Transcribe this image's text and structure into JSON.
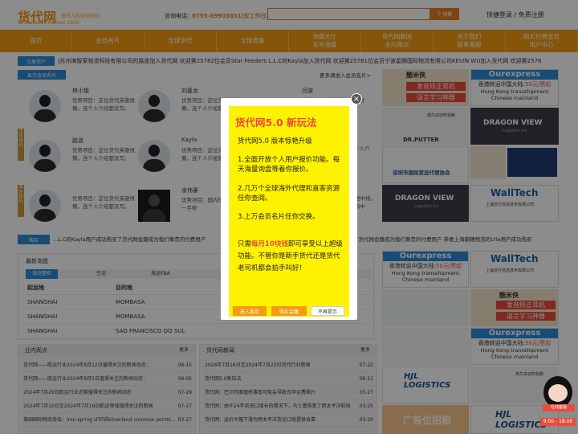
{
  "header": {
    "logo": "货代网",
    "logo_sub": "货代人的社交网站",
    "logo_url": "forwarders.cn  Since 2019",
    "phone_label": "咨询电话：",
    "phone": "0755-89903031(仅工作日)",
    "search_placeholder": "",
    "search_button": "搜集",
    "login": "快捷登录",
    "register": "免费注册"
  },
  "nav": [
    "首页",
    "会员名片",
    "全球货代",
    "全球直客",
    "询盘大厅\n发布询盘",
    "货代网新闻\n业内观点",
    "关于我们\n联系客服",
    "购买付费会员\n用户中心"
  ],
  "ticker": {
    "tag": "注册用户",
    "text": "|苏州海智家物流科技有限公司的路遥加入货代网      欢迎第25782位会员Star Feeders L.L.C的Kayla加入货代网      欢迎第25781位会员宁波星腾国际物流有限公司KEVIN WU加入货代网      欢迎第2578"
  },
  "cards_section": {
    "tag": "显示会员名片",
    "more": "更多请进入会员名片>"
  },
  "cards": [
    {
      "name": "林小姐",
      "desc": "优势项目：这位货代英雄很懒，连个人介绍都没写。"
    },
    {
      "name": "刘嘉龙",
      "desc": "优势项目：这位货代英雄很懒，连个人介绍都没写。"
    },
    {
      "name": "闫波",
      "desc": "优势项目：这位货代英雄很懒，连个人介绍都没写。"
    },
    {
      "name": "路遥",
      "desc": "优势项目：这位货代英雄很懒，连个人介绍都没写。"
    },
    {
      "name": "Kayla",
      "desc": "优势项目：这位货代英雄很懒，连个人介绍都没写。"
    },
    {
      "name": "",
      "desc": "这位货代英雄很懒，连个人介绍都没写。"
    },
    {
      "name": "",
      "desc": "优势项目：这位货代英雄很懒，连个人介绍都没写。"
    },
    {
      "name": "余伟豪",
      "desc": "优势项目：国内快递 NVO货、一手柜"
    },
    {
      "name": "",
      "desc": "地中线，和中"
    }
  ],
  "news_ticker": {
    "tag": "购买",
    "text": "...L.C的Kayla用户成功购买了货代网会籍成为我们尊贵的付费用户",
    "text_right": "了货代网会籍成为我们尊贵的付费用户      恭喜上海朝穗物流的LYle用户成功购买"
  },
  "routes": {
    "title": "最新询盘",
    "tabs": [
      "海运整柜",
      "空运",
      "海运FBA",
      "车"
    ],
    "headers": [
      "起运地",
      "目的地"
    ],
    "rows": [
      [
        "SHANGHAI",
        "MOMBASA"
      ],
      [
        "SHANGHAI",
        "MOMBASA"
      ],
      [
        "SHANGHAI",
        "SAO FRANCISCO DO SUL"
      ]
    ]
  },
  "lists": [
    {
      "title": "业内观点",
      "more": "更多",
      "rows": [
        [
          "货代网——航运行业2024年8月12日值得关注的新闻动态：",
          "08-15"
        ],
        [
          "货代网——航运行业2024年8月5日值得关注的新闻动态：",
          "08-05"
        ],
        [
          "2024年7月29日航运行业近期值得关注的新闻动态",
          "07-29"
        ],
        [
          "2024年7月10日至2024年7月16日航运领域值得关注的新闻",
          "07-17"
        ],
        [
          "美国国际物流协会：iron spring UT内陆Overland common points...",
          "03-27"
        ]
      ]
    },
    {
      "title": "货代网新闻",
      "more": "更多",
      "rows": [
        [
          "2024年7月16日至2024年7月22日货代行业新闻",
          "07-22"
        ],
        [
          "货代网5.0新玩法",
          "06-11"
        ],
        [
          "货代网：巴尔的摩撞桥事故可能会导致东岸运费飙升",
          "03-27"
        ],
        [
          "货代网：由于24年初进口增长的情况下，马士基恢复了跨太平洋航线",
          "03-25"
        ],
        [
          "货代网：运价大幅下滑为跨太平洋货运订舱提供肯靠",
          "03-20"
        ]
      ]
    }
  ],
  "ads": {
    "ourexpress": "Ourexpress",
    "ourexpress_sub": "香港转运中国大陆:",
    "ourexpress_price": "50元/票起",
    "ourexpress_en": "Hong Kong transshipment Chinese mainland",
    "kumi": "酷米侠",
    "kumi_sub": "发音矫正耳机",
    "kumi_sub2": "语言学习神器",
    "dragon": "DRAGON VIEW",
    "dragon_sub": "Logistics Inc",
    "drputter": "DR.PUTTER",
    "drputter_cn": "高尔夫切杆割刷",
    "wall": "WallTech",
    "wall_sub": "上海沃行信息技术有限公司",
    "shenzhen": "深圳市国际货运代理协会",
    "hjl": "HJL LOGISTICS",
    "ad_slot": "广告位招租"
  },
  "modal": {
    "title": "货代网5.0 新玩法",
    "l1": "货代网5.0 版本惊艳升级",
    "l2": "1.全面开放个人用户报价功能。每天海量询盘等着你报价。",
    "l3": "2.几万个全球海外代理和直客资源任你查阅。",
    "l4": "3.上万会员名片任你交换。",
    "l5a": "只需",
    "l5b": "每月10块钱",
    "l5c": "即可享受以上超级功能。不管你是新手货代还是货代老司机都会拍手叫好！",
    "btn1": "进入首页",
    "btn2": "购买会籍",
    "btn3": "不再提示"
  },
  "chat": {
    "label": "在线客服",
    "time": "9:00 - 18:00"
  },
  "colors": {
    "brand": "#f39c12",
    "blue": "#2a8ad8",
    "modal_bg": "#fff200",
    "highlight": "#e74c3c"
  }
}
